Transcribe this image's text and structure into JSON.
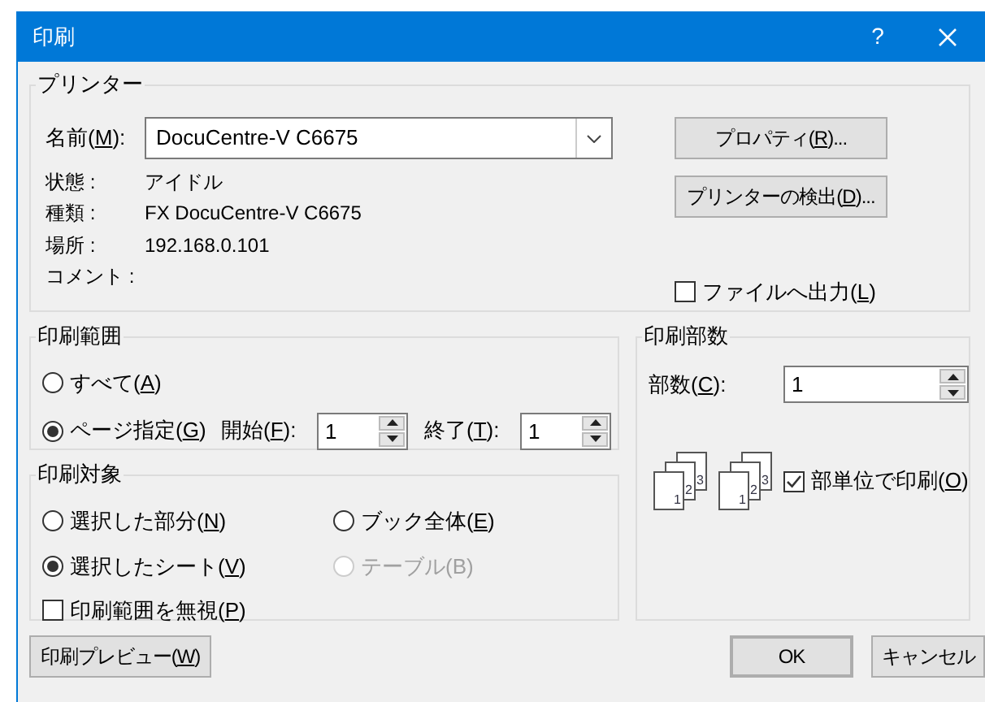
{
  "window": {
    "title": "印刷",
    "help": "?"
  },
  "printer": {
    "group_label": "プリンター",
    "name_label": "名前(M):",
    "name_value": "DocuCentre-V C6675",
    "info": [
      {
        "label": "状態 :",
        "value": "アイドル"
      },
      {
        "label": "種類 :",
        "value": "FX DocuCentre-V C6675"
      },
      {
        "label": "場所 :",
        "value": "192.168.0.101"
      },
      {
        "label": "コメント :"
      }
    ],
    "buttons": [
      "プロパティ(R)...",
      "プリンターの検出(D)..."
    ],
    "print_to_file": {
      "label": "ファイルへ出力(L)",
      "checked": false
    }
  },
  "print_range": {
    "group_label": "印刷範囲",
    "options": [
      {
        "label": "すべて(A)",
        "selected": false
      },
      {
        "label": "ページ指定(G)",
        "selected": true
      }
    ],
    "from": {
      "label": "開始(F):",
      "value": "1"
    },
    "to": {
      "label": "終了(T):",
      "value": "1"
    }
  },
  "print_what": {
    "group_label": "印刷対象",
    "options": [
      {
        "label": "選択した部分(N)",
        "selected": false,
        "disabled": false
      },
      {
        "label": "ブック全体(E)",
        "selected": false,
        "disabled": false
      },
      {
        "label": "選択したシート(V)",
        "selected": true,
        "disabled": false
      },
      {
        "label": "テーブル(B)",
        "selected": false,
        "disabled": true
      }
    ],
    "ignore_print_areas": {
      "label": "印刷範囲を無視(P)",
      "checked": false
    }
  },
  "copies": {
    "group_label": "印刷部数",
    "count_label": "部数(C):",
    "count_value": "1",
    "collate_icons": [
      {
        "pages": [
          "1",
          "2",
          "3"
        ]
      },
      {
        "pages": [
          "1",
          "2",
          "3"
        ]
      }
    ],
    "collate": {
      "label": "部単位で印刷(O)",
      "checked": true
    }
  },
  "buttons": {
    "preview": "印刷プレビュー(W)",
    "ok": "OK",
    "cancel": "キャンセル"
  }
}
